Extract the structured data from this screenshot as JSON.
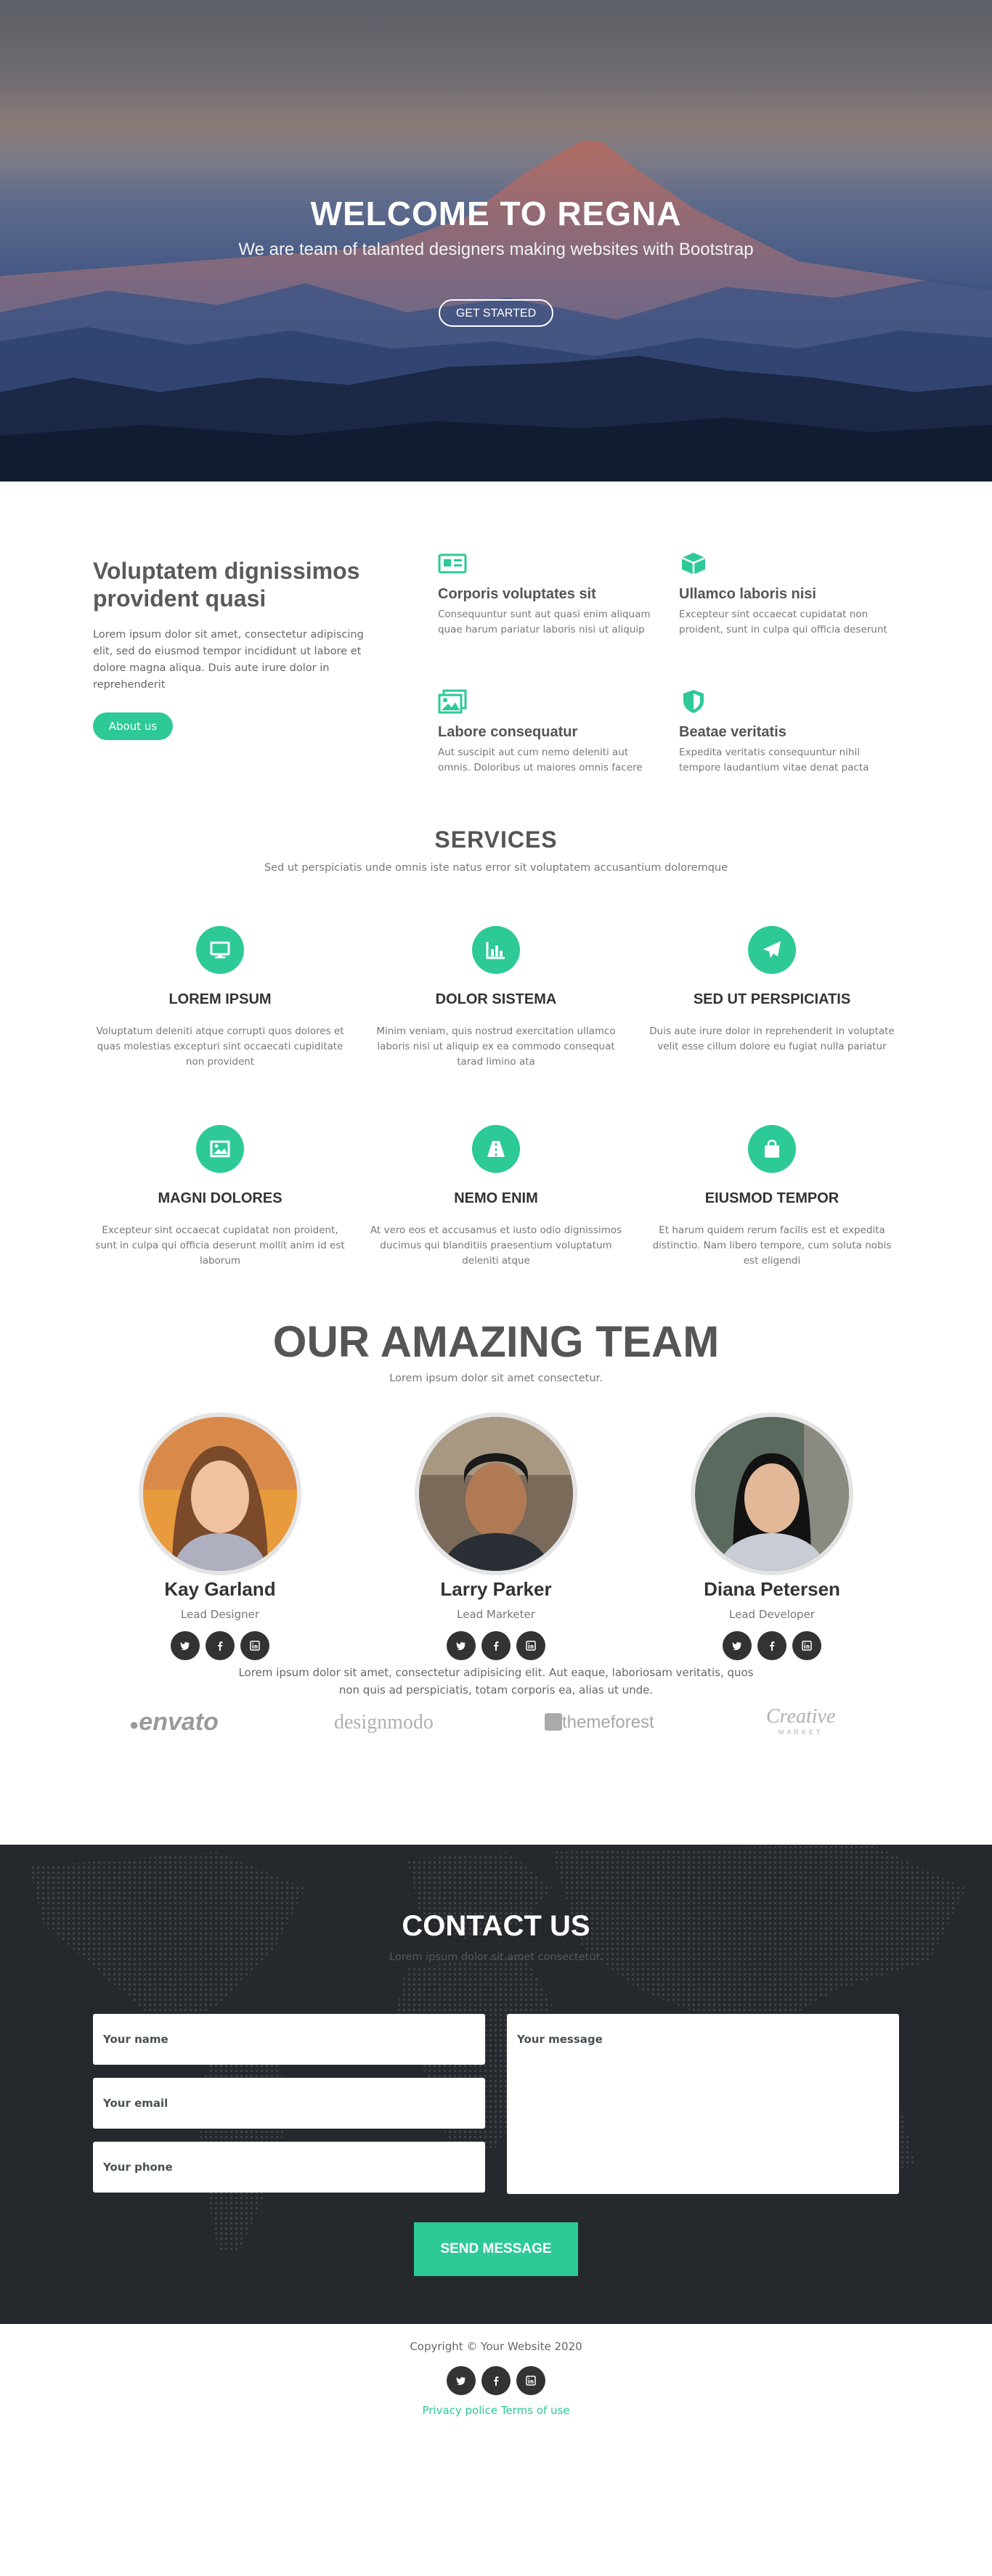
{
  "hero": {
    "title": "WELCOME TO REGNA",
    "subtitle": "We are team of talanted designers making websites with Bootstrap",
    "cta": "GET STARTED"
  },
  "about": {
    "title": "Voluptatem dignissimos provident quasi",
    "text": "Lorem ipsum dolor sit amet, consectetur adipiscing elit, sed do eiusmod tempor incididunt ut labore et dolore magna aliqua. Duis aute irure dolor in reprehenderit",
    "button": "About us",
    "features": [
      {
        "icon": "newspaper-icon",
        "title": "Corporis voluptates sit",
        "text": "Consequuntur sunt aut quasi enim aliquam quae harum pariatur laboris nisi ut aliquip"
      },
      {
        "icon": "cube-icon",
        "title": "Ullamco laboris nisi",
        "text": "Excepteur sint occaecat cupidatat non proident, sunt in culpa qui officia deserunt"
      },
      {
        "icon": "images-icon",
        "title": "Labore consequatur",
        "text": "Aut suscipit aut cum nemo deleniti aut omnis. Doloribus ut maiores omnis facere"
      },
      {
        "icon": "shield-icon",
        "title": "Beatae veritatis",
        "text": "Expedita veritatis consequuntur nihil tempore laudantium vitae denat pacta"
      }
    ]
  },
  "services": {
    "title": "SERVICES",
    "subtitle": "Sed ut perspiciatis unde omnis iste natus error sit voluptatem accusantium doloremque",
    "items": [
      {
        "icon": "desktop-icon",
        "title": "LOREM IPSUM",
        "text": "Voluptatum deleniti atque corrupti quos dolores et quas molestias excepturi sint occaecati cupiditate non provident"
      },
      {
        "icon": "bar-chart-icon",
        "title": "DOLOR SISTEMA",
        "text": "Minim veniam, quis nostrud exercitation ullamco laboris nisi ut aliquip ex ea commodo consequat tarad limino ata"
      },
      {
        "icon": "paper-plane-icon",
        "title": "SED UT PERSPICIATIS",
        "text": "Duis aute irure dolor in reprehenderit in voluptate velit esse cillum dolore eu fugiat nulla pariatur"
      },
      {
        "icon": "image-icon",
        "title": "MAGNI DOLORES",
        "text": "Excepteur sint occaecat cupidatat non proident, sunt in culpa qui officia deserunt mollit anim id est laborum"
      },
      {
        "icon": "road-icon",
        "title": "NEMO ENIM",
        "text": "At vero eos et accusamus et iusto odio dignissimos ducimus qui blanditiis praesentium voluptatum deleniti atque"
      },
      {
        "icon": "shopping-bag-icon",
        "title": "EIUSMOD TEMPOR",
        "text": "Et harum quidem rerum facilis est et expedita distinctio. Nam libero tempore, cum soluta nobis est eligendi"
      }
    ]
  },
  "team": {
    "title": "OUR AMAZING TEAM",
    "subtitle": "Lorem ipsum dolor sit amet consectetur.",
    "members": [
      {
        "name": "Kay Garland",
        "role": "Lead Designer"
      },
      {
        "name": "Larry Parker",
        "role": "Lead Marketer"
      },
      {
        "name": "Diana Petersen",
        "role": "Lead Developer"
      }
    ],
    "text": "Lorem ipsum dolor sit amet, consectetur adipisicing elit. Aut eaque, laboriosam veritatis, quos non quis ad perspiciatis, totam corporis ea, alias ut unde."
  },
  "clients": [
    "envato",
    "designmodo",
    "themeforest",
    "Creative"
  ],
  "clients_sub": "MARKET",
  "contact": {
    "title": "CONTACT US",
    "subtitle": "Lorem ipsum dolor sit amet consectetur.",
    "name_placeholder": "Your name",
    "email_placeholder": "Your email",
    "phone_placeholder": "Your phone",
    "message_placeholder": "Your message",
    "send": "SEND MESSAGE"
  },
  "footer": {
    "copyright": "Copyright © Your Website 2020",
    "privacy": "Privacy police",
    "terms": "Terms of use"
  },
  "colors": {
    "accent": "#2dc997",
    "dark": "#25282c"
  }
}
